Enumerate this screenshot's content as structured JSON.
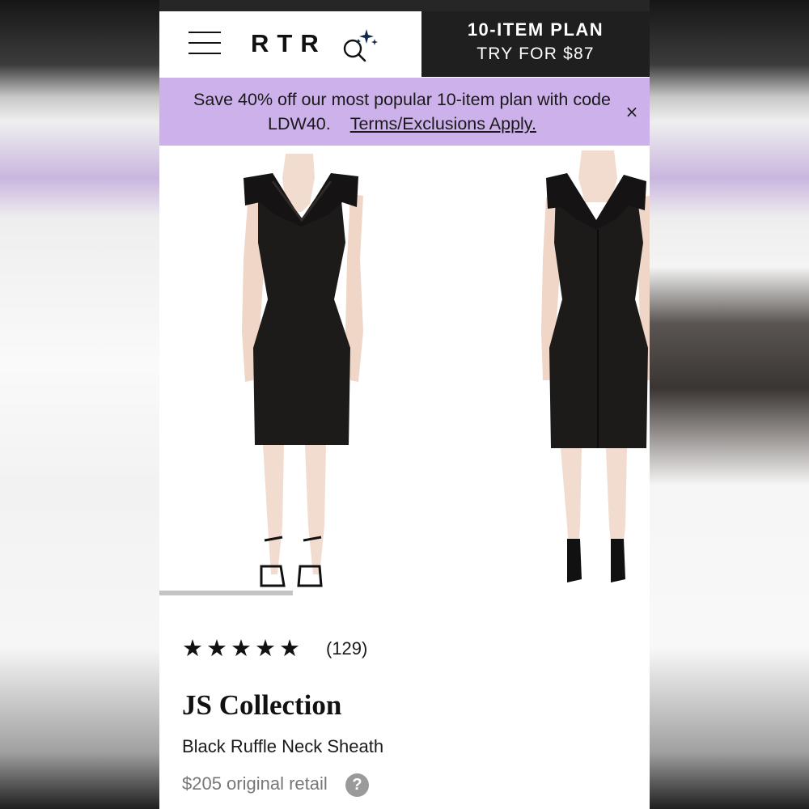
{
  "header": {
    "logo": "RTR",
    "plan_line1": "10-ITEM PLAN",
    "plan_line2": "TRY FOR $87"
  },
  "promo": {
    "message": "Save 40% off our most popular 10-item plan with code LDW40.",
    "terms_link": "Terms/Exclusions Apply.",
    "close_symbol": "×"
  },
  "gallery": {
    "images": [
      "front-view",
      "back-view"
    ],
    "scroll_position": 0.27
  },
  "product": {
    "stars": "★★★★★",
    "rating_value": 5,
    "review_count": "(129)",
    "brand": "JS Collection",
    "name": "Black Ruffle Neck Sheath",
    "retail": "$205 original retail",
    "info_icon": "?"
  },
  "colors": {
    "promo_bg": "#cdb1ea",
    "plan_bg": "#1f1f1f",
    "text": "#111111",
    "muted": "#777777"
  }
}
